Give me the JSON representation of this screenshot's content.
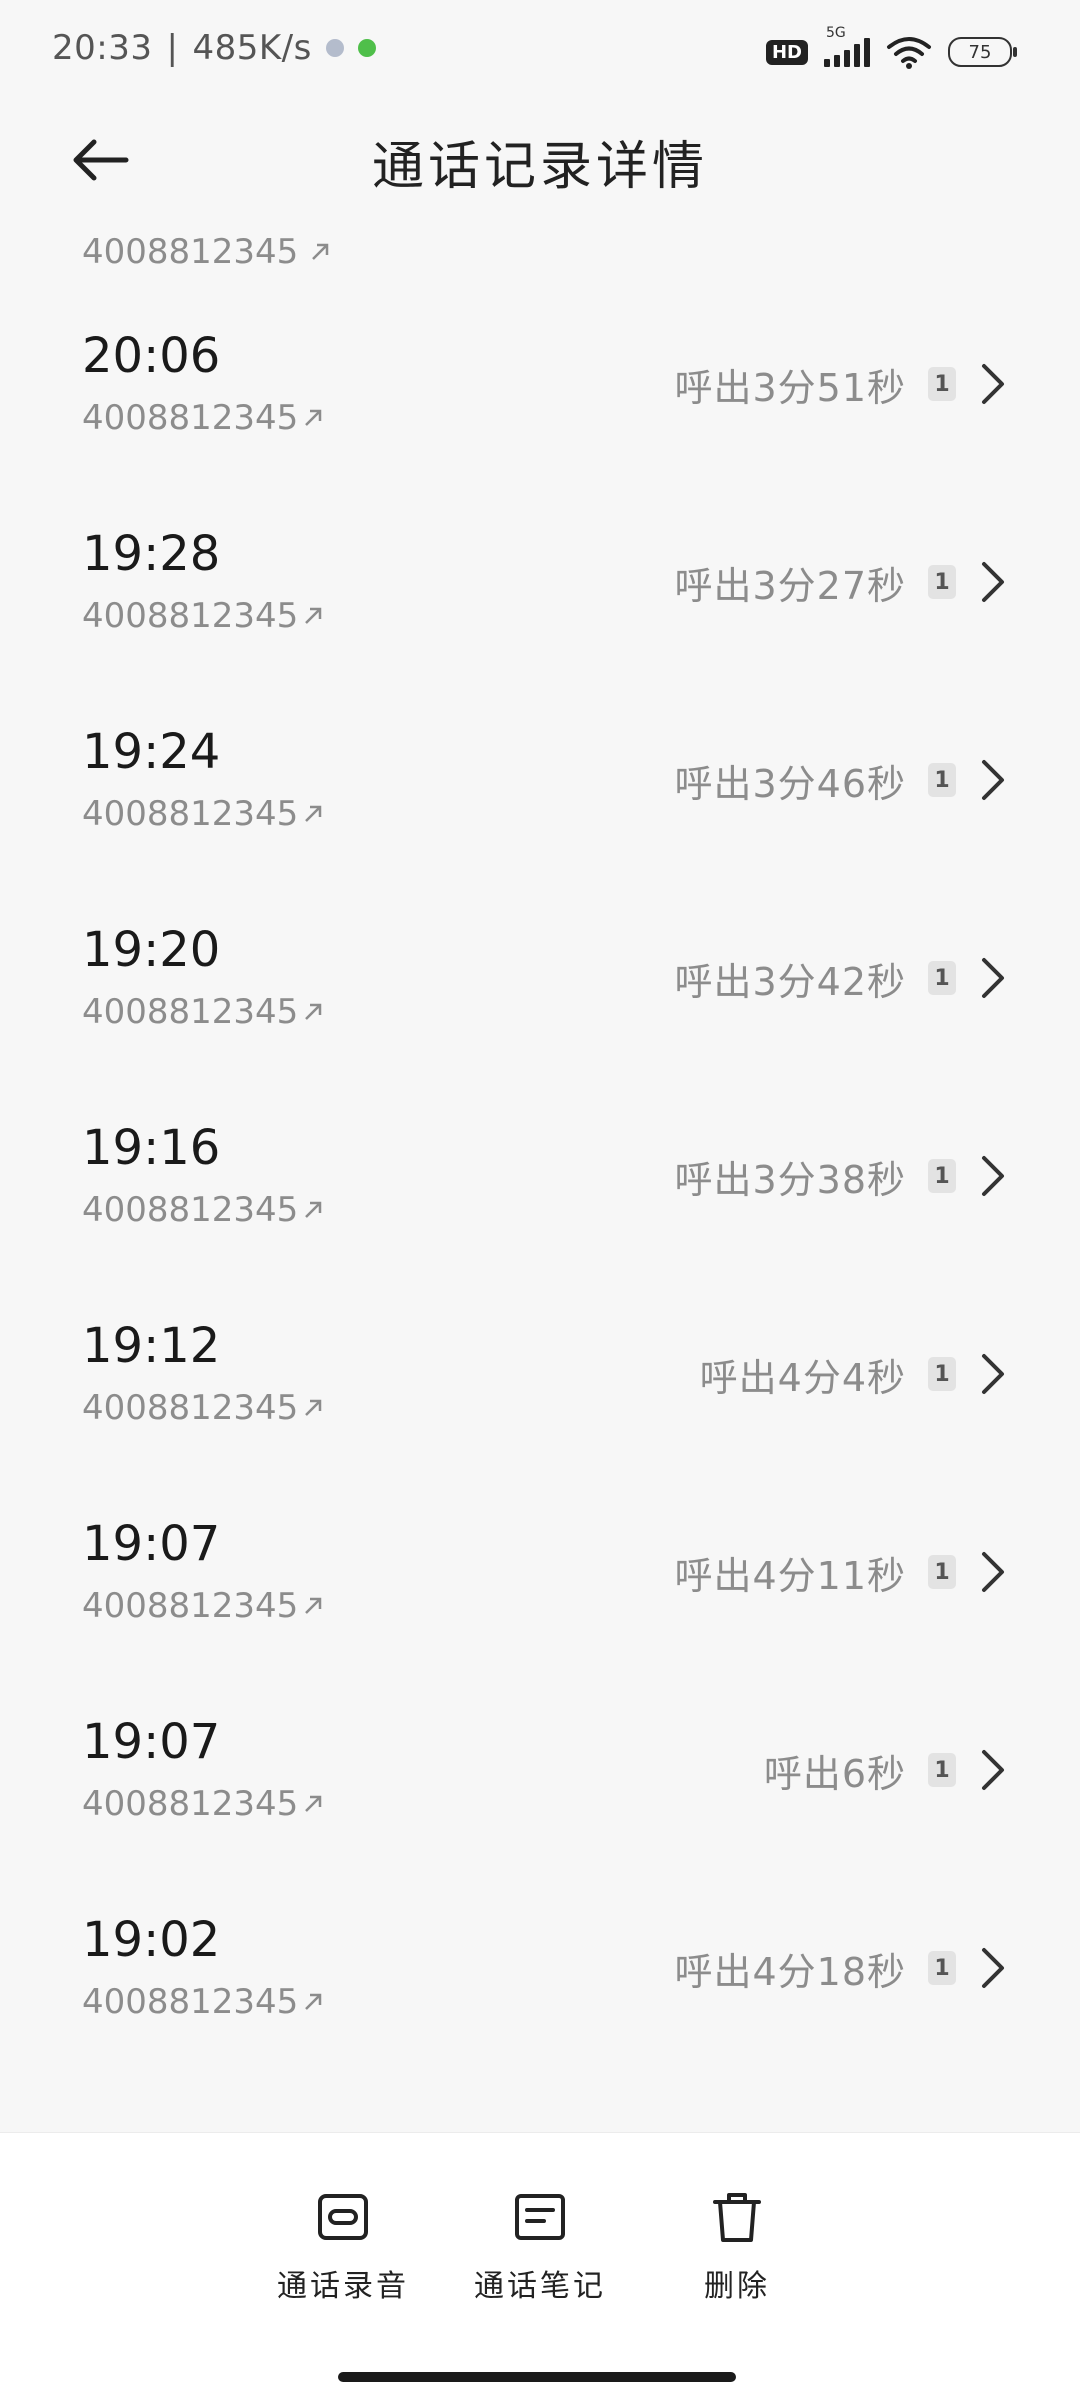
{
  "status_bar": {
    "time": "20:33",
    "net_speed": "485K/s",
    "hd_badge": "HD",
    "network_type": "5G",
    "battery": "75"
  },
  "header": {
    "title": "通话记录详情"
  },
  "partial_row": {
    "number": "4008812345"
  },
  "calls": [
    {
      "time": "20:06",
      "number": "4008812345",
      "duration": "呼出3分51秒",
      "sim": "1"
    },
    {
      "time": "19:28",
      "number": "4008812345",
      "duration": "呼出3分27秒",
      "sim": "1"
    },
    {
      "time": "19:24",
      "number": "4008812345",
      "duration": "呼出3分46秒",
      "sim": "1"
    },
    {
      "time": "19:20",
      "number": "4008812345",
      "duration": "呼出3分42秒",
      "sim": "1"
    },
    {
      "time": "19:16",
      "number": "4008812345",
      "duration": "呼出3分38秒",
      "sim": "1"
    },
    {
      "time": "19:12",
      "number": "4008812345",
      "duration": "呼出4分4秒",
      "sim": "1"
    },
    {
      "time": "19:07",
      "number": "4008812345",
      "duration": "呼出4分11秒",
      "sim": "1"
    },
    {
      "time": "19:07",
      "number": "4008812345",
      "duration": "呼出6秒",
      "sim": "1"
    },
    {
      "time": "19:02",
      "number": "4008812345",
      "duration": "呼出4分18秒",
      "sim": "1"
    }
  ],
  "toolbar": {
    "recording_label": "通话录音",
    "notes_label": "通话笔记",
    "delete_label": "删除"
  },
  "icons": {
    "back": "back-arrow-icon",
    "outgoing": "outgoing-arrow-icon",
    "chevron": "chevron-right-icon",
    "recording": "cassette-icon",
    "notes": "note-icon",
    "delete": "trash-icon"
  },
  "colors": {
    "background": "#f7f7f7",
    "secondary_text": "#8c8c8c",
    "toolbar_bg": "#ffffff"
  }
}
